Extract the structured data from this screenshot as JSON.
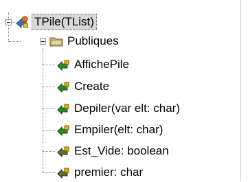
{
  "tree": {
    "root": {
      "label": "TPile(TList)",
      "icon": "class-icon",
      "expanded": true,
      "selected": true,
      "children": [
        {
          "label": "Publiques",
          "icon": "folder-icon",
          "expanded": true,
          "items": [
            {
              "label": "AffichePile",
              "icon": "method-icon"
            },
            {
              "label": "Create",
              "icon": "method-icon"
            },
            {
              "label": "Depiler(var elt: char)",
              "icon": "method-icon"
            },
            {
              "label": "Empiler(elt: char)",
              "icon": "method-icon"
            },
            {
              "label": "Est_Vide: boolean",
              "icon": "function-icon"
            },
            {
              "label": "premier: char",
              "icon": "function-icon"
            }
          ]
        }
      ]
    }
  }
}
